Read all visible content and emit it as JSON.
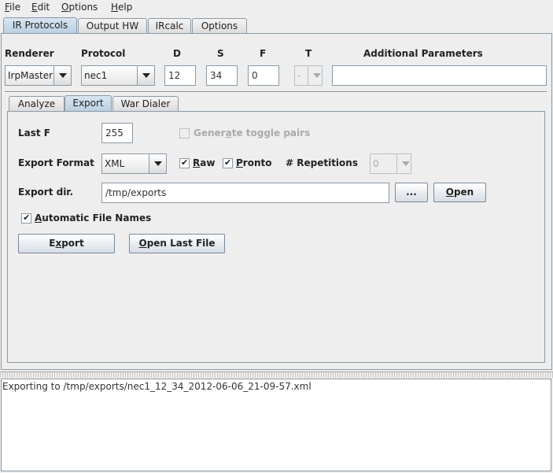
{
  "menubar": {
    "items": [
      {
        "label": "File",
        "mnemonic": "F",
        "rest": "ile"
      },
      {
        "label": "Edit",
        "mnemonic": "E",
        "rest": "dit"
      },
      {
        "label": "Options",
        "mnemonic": "O",
        "rest": "ptions"
      },
      {
        "label": "Help",
        "mnemonic": "H",
        "rest": "elp"
      }
    ]
  },
  "top_tabs": [
    "IR Protocols",
    "Output HW",
    "IRcalc",
    "Options"
  ],
  "params": {
    "renderer_label": "Renderer",
    "protocol_label": "Protocol",
    "d_label": "D",
    "s_label": "S",
    "f_label": "F",
    "t_label": "T",
    "additional_label": "Additional Parameters",
    "renderer_value": "IrpMaster",
    "protocol_value": "nec1",
    "d_value": "12",
    "s_value": "34",
    "f_value": "0",
    "t_value": "-",
    "additional_value": ""
  },
  "sub_tabs": [
    "Analyze",
    "Export",
    "War Dialer"
  ],
  "export": {
    "last_f_label": "Last F",
    "last_f_value": "255",
    "toggle_pre": "Gener",
    "toggle_mnemonic": "a",
    "toggle_post": "te toggle pairs",
    "format_label": "Export Format",
    "format_value": "XML",
    "raw_mnemonic": "R",
    "raw_rest": "aw",
    "pronto_mnemonic": "P",
    "pronto_rest": "ronto",
    "repetitions_label": "# Repetitions",
    "repetitions_value": "0",
    "dir_label": "Export dir.",
    "dir_value": "/tmp/exports",
    "browse_label": "...",
    "open_mnemonic": "O",
    "open_rest": "pen",
    "auto_mnemonic": "A",
    "auto_rest": "utomatic File Names",
    "export_pre": "E",
    "export_mnemonic": "x",
    "export_post": "port",
    "open_last_mnemonic": "O",
    "open_last_rest": "pen Last File"
  },
  "console": {
    "text": "Exporting to /tmp/exports/nec1_12_34_2012-06-06_21-09-57.xml"
  },
  "colors": {
    "selected_tab": "#c4d8e8",
    "border": "#8a99a6",
    "background": "#eeeeee"
  }
}
